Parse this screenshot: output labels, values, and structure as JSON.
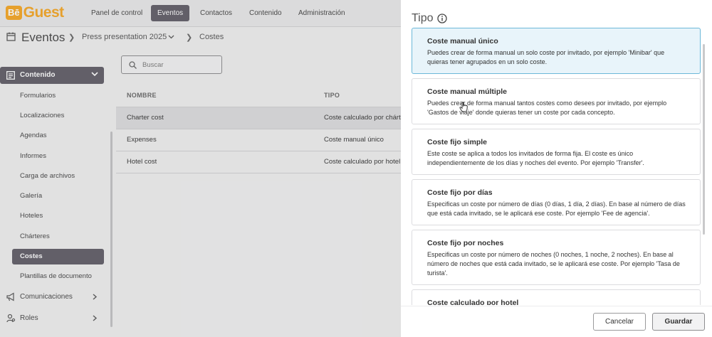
{
  "logo": {
    "badge": "Bē",
    "text": "Guest"
  },
  "topnav": {
    "items": [
      {
        "label": "Panel de control"
      },
      {
        "label": "Eventos"
      },
      {
        "label": "Contactos"
      },
      {
        "label": "Contenido"
      },
      {
        "label": "Administración"
      }
    ]
  },
  "breadcrumb": {
    "title": "Eventos",
    "event": "Press presentation 2025",
    "section": "Costes"
  },
  "sidebar": {
    "section": "Contenido",
    "items": [
      {
        "label": "Formularios"
      },
      {
        "label": "Localizaciones"
      },
      {
        "label": "Agendas"
      },
      {
        "label": "Informes"
      },
      {
        "label": "Carga de archivos"
      },
      {
        "label": "Galería"
      },
      {
        "label": "Hoteles"
      },
      {
        "label": "Chárteres"
      },
      {
        "label": "Costes"
      },
      {
        "label": "Plantillas de documento"
      }
    ],
    "groups": [
      {
        "label": "Comunicaciones"
      },
      {
        "label": "Roles"
      }
    ]
  },
  "search": {
    "placeholder": "Buscar"
  },
  "table": {
    "columns": [
      "NOMBRE",
      "TIPO"
    ],
    "rows": [
      {
        "name": "Charter cost",
        "type": "Coste calculado por chárter"
      },
      {
        "name": "Expenses",
        "type": "Coste manual único"
      },
      {
        "name": "Hotel cost",
        "type": "Coste calculado por hotel"
      }
    ]
  },
  "panel": {
    "title": "Tipo",
    "options": [
      {
        "title": "Coste manual único",
        "desc": "Puedes crear de forma manual un solo coste por invitado, por ejemplo 'Minibar' que quieras tener agrupados en un solo coste."
      },
      {
        "title": "Coste manual múltiple",
        "desc": "Puedes crear de forma manual tantos costes como desees por invitado, por ejemplo 'Gastos de viaje' donde quieras tener un coste por cada concepto."
      },
      {
        "title": "Coste fijo simple",
        "desc": "Este coste se aplica a todos los invitados de forma fija. El coste es único independientemente de los días y noches del evento. Por ejemplo 'Transfer'."
      },
      {
        "title": "Coste fijo por días",
        "desc": "Especificas un coste por número de días (0 días, 1 día, 2 días). En base al número de días que está cada invitado, se le aplicará ese coste. Por ejemplo 'Fee de agencia'."
      },
      {
        "title": "Coste fijo por noches",
        "desc": "Especificas un coste por número de noches (0 noches, 1 noche, 2 noches). En base al número de noches que está cada invitado, se le aplicará ese coste. Por ejemplo 'Tasa de turista'."
      },
      {
        "title": "Coste calculado por hotel",
        "desc": ""
      }
    ],
    "cancel": "Cancelar",
    "save": "Guardar"
  },
  "colors": {
    "accent": "#f5a623",
    "nav_active": "#5f5c66",
    "selected_card_bg": "#e8f4fa",
    "selected_card_border": "#6cb8d9"
  }
}
